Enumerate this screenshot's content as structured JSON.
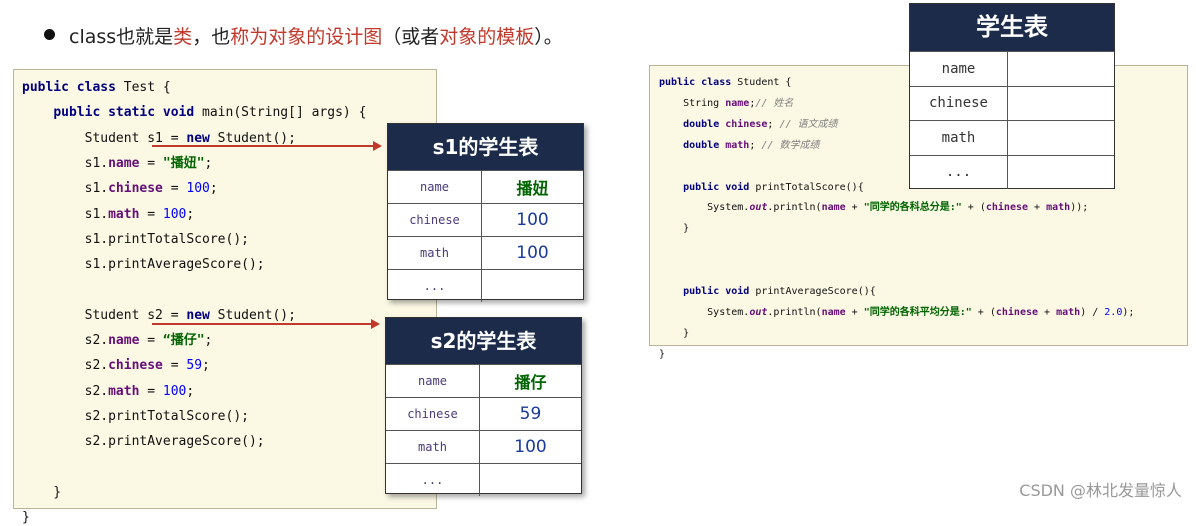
{
  "heading": {
    "parts": [
      {
        "text": "class也就是",
        "red": false
      },
      {
        "text": "类",
        "red": true
      },
      {
        "text": "，也",
        "red": false
      },
      {
        "text": "称为对象的设计图",
        "red": true
      },
      {
        "text": "（或者",
        "red": false
      },
      {
        "text": "对象的模板",
        "red": true
      },
      {
        "text": "）。",
        "red": false
      }
    ]
  },
  "left_code": [
    [
      {
        "t": "public class",
        "c": "kw"
      },
      {
        "t": " Test {",
        "c": ""
      }
    ],
    [
      {
        "t": "    ",
        "c": ""
      },
      {
        "t": "public static void",
        "c": "kw"
      },
      {
        "t": " main(String[] args) {",
        "c": ""
      }
    ],
    [
      {
        "t": "        Student s1 = ",
        "c": ""
      },
      {
        "t": "new",
        "c": "kw"
      },
      {
        "t": " Student();",
        "c": ""
      }
    ],
    [
      {
        "t": "        s1.",
        "c": ""
      },
      {
        "t": "name",
        "c": "fld"
      },
      {
        "t": " = ",
        "c": ""
      },
      {
        "t": "\"播妞\"",
        "c": "str"
      },
      {
        "t": ";",
        "c": ""
      }
    ],
    [
      {
        "t": "        s1.",
        "c": ""
      },
      {
        "t": "chinese",
        "c": "fld"
      },
      {
        "t": " = ",
        "c": ""
      },
      {
        "t": "100",
        "c": "num"
      },
      {
        "t": ";",
        "c": ""
      }
    ],
    [
      {
        "t": "        s1.",
        "c": ""
      },
      {
        "t": "math",
        "c": "fld"
      },
      {
        "t": " = ",
        "c": ""
      },
      {
        "t": "100",
        "c": "num"
      },
      {
        "t": ";",
        "c": ""
      }
    ],
    [
      {
        "t": "        s1.printTotalScore();",
        "c": ""
      }
    ],
    [
      {
        "t": "        s1.printAverageScore();",
        "c": ""
      }
    ],
    [
      {
        "t": "",
        "c": ""
      }
    ],
    [
      {
        "t": "        Student s2 = ",
        "c": ""
      },
      {
        "t": "new",
        "c": "kw"
      },
      {
        "t": " Student();",
        "c": ""
      }
    ],
    [
      {
        "t": "        s2.",
        "c": ""
      },
      {
        "t": "name",
        "c": "fld"
      },
      {
        "t": " = ",
        "c": ""
      },
      {
        "t": "“播仔\"",
        "c": "str"
      },
      {
        "t": ";",
        "c": ""
      }
    ],
    [
      {
        "t": "        s2.",
        "c": ""
      },
      {
        "t": "chinese",
        "c": "fld"
      },
      {
        "t": " = ",
        "c": ""
      },
      {
        "t": "59",
        "c": "num"
      },
      {
        "t": ";",
        "c": ""
      }
    ],
    [
      {
        "t": "        s2.",
        "c": ""
      },
      {
        "t": "math",
        "c": "fld"
      },
      {
        "t": " = ",
        "c": ""
      },
      {
        "t": "100",
        "c": "num"
      },
      {
        "t": ";",
        "c": ""
      }
    ],
    [
      {
        "t": "        s2.printTotalScore();",
        "c": ""
      }
    ],
    [
      {
        "t": "        s2.printAverageScore();",
        "c": ""
      }
    ],
    [
      {
        "t": "",
        "c": ""
      }
    ],
    [
      {
        "t": "    }",
        "c": ""
      }
    ],
    [
      {
        "t": "}",
        "c": ""
      }
    ]
  ],
  "right_code": [
    [
      {
        "t": "public class",
        "c": "kw"
      },
      {
        "t": " Student {",
        "c": ""
      }
    ],
    [
      {
        "t": "    String ",
        "c": ""
      },
      {
        "t": "name",
        "c": "fld"
      },
      {
        "t": ";",
        "c": ""
      },
      {
        "t": "// 姓名",
        "c": "cmt"
      }
    ],
    [
      {
        "t": "    ",
        "c": ""
      },
      {
        "t": "double",
        "c": "kw"
      },
      {
        "t": " ",
        "c": ""
      },
      {
        "t": "chinese",
        "c": "fld"
      },
      {
        "t": "; ",
        "c": ""
      },
      {
        "t": "// 语文成绩",
        "c": "cmt"
      }
    ],
    [
      {
        "t": "    ",
        "c": ""
      },
      {
        "t": "double",
        "c": "kw"
      },
      {
        "t": " ",
        "c": ""
      },
      {
        "t": "math",
        "c": "fld"
      },
      {
        "t": "; ",
        "c": ""
      },
      {
        "t": "// 数学成绩",
        "c": "cmt"
      }
    ],
    [
      {
        "t": "",
        "c": ""
      }
    ],
    [
      {
        "t": "    ",
        "c": ""
      },
      {
        "t": "public void",
        "c": "kw"
      },
      {
        "t": " printTotalScore(){",
        "c": ""
      }
    ],
    [
      {
        "t": "        System.",
        "c": ""
      },
      {
        "t": "out",
        "c": "itf"
      },
      {
        "t": ".println(",
        "c": ""
      },
      {
        "t": "name",
        "c": "fld"
      },
      {
        "t": " + ",
        "c": ""
      },
      {
        "t": "\"同学的各科总分是:\"",
        "c": "str"
      },
      {
        "t": " + (",
        "c": ""
      },
      {
        "t": "chinese",
        "c": "fld"
      },
      {
        "t": " + ",
        "c": ""
      },
      {
        "t": "math",
        "c": "fld"
      },
      {
        "t": "));",
        "c": ""
      }
    ],
    [
      {
        "t": "    }",
        "c": ""
      }
    ],
    [
      {
        "t": "",
        "c": ""
      }
    ],
    [
      {
        "t": "",
        "c": ""
      }
    ],
    [
      {
        "t": "    ",
        "c": ""
      },
      {
        "t": "public void",
        "c": "kw"
      },
      {
        "t": " printAverageScore(){",
        "c": ""
      }
    ],
    [
      {
        "t": "        System.",
        "c": ""
      },
      {
        "t": "out",
        "c": "itf"
      },
      {
        "t": ".println(",
        "c": ""
      },
      {
        "t": "name",
        "c": "fld"
      },
      {
        "t": " + ",
        "c": ""
      },
      {
        "t": "\"同学的各科平均分是:\"",
        "c": "str"
      },
      {
        "t": " + (",
        "c": ""
      },
      {
        "t": "chinese",
        "c": "fld"
      },
      {
        "t": " + ",
        "c": ""
      },
      {
        "t": "math",
        "c": "fld"
      },
      {
        "t": ") / ",
        "c": ""
      },
      {
        "t": "2.0",
        "c": "num"
      },
      {
        "t": ");",
        "c": ""
      }
    ],
    [
      {
        "t": "    }",
        "c": ""
      }
    ],
    [
      {
        "t": "}",
        "c": ""
      }
    ]
  ],
  "s1_table": {
    "title": "s1的学生表",
    "rows": [
      {
        "key": "name",
        "value": "播妞",
        "style": "green"
      },
      {
        "key": "chinese",
        "value": "100",
        "style": "blue"
      },
      {
        "key": "math",
        "value": "100",
        "style": "blue"
      },
      {
        "key": "...",
        "value": "",
        "style": "blue"
      }
    ]
  },
  "s2_table": {
    "title": "s2的学生表",
    "rows": [
      {
        "key": "name",
        "value": "播仔",
        "style": "green"
      },
      {
        "key": "chinese",
        "value": "59",
        "style": "blue"
      },
      {
        "key": "math",
        "value": "100",
        "style": "blue"
      },
      {
        "key": "...",
        "value": "",
        "style": "blue"
      }
    ]
  },
  "student_table": {
    "title": "学生表",
    "rows": [
      {
        "key": "name",
        "value": "",
        "style": "blue"
      },
      {
        "key": "chinese",
        "value": "",
        "style": "blue"
      },
      {
        "key": "math",
        "value": "",
        "style": "blue"
      },
      {
        "key": "...",
        "value": "",
        "style": "blue"
      }
    ]
  },
  "watermark": "CSDN @林北发量惊人",
  "colors": {
    "accent_red": "#c0392b",
    "table_header": "#1c2b4a",
    "code_bg": "#fbf8e4"
  }
}
